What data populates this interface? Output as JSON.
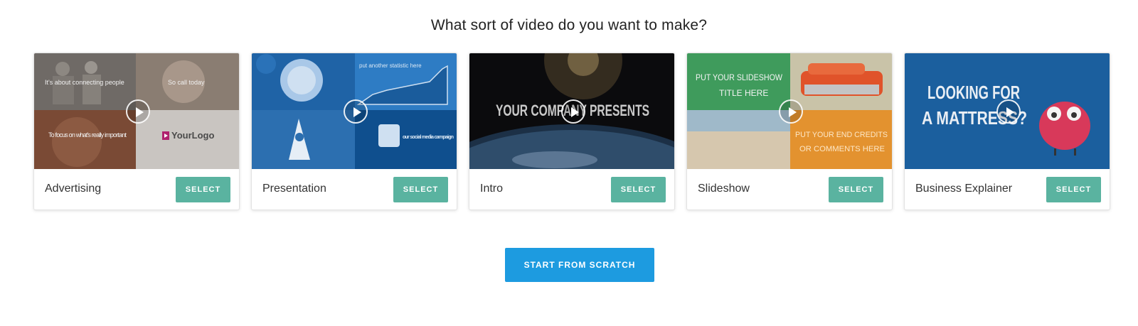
{
  "heading": "What sort of video do you want to make?",
  "cards": [
    {
      "label": "Advertising",
      "select_label": "SELECT",
      "thumb_text": [
        "It's about connecting people",
        "So call today",
        "To focus on what's really important",
        "YourLogo"
      ]
    },
    {
      "label": "Presentation",
      "select_label": "SELECT",
      "thumb_text": [
        "put another statistic here",
        "our social media campaign"
      ]
    },
    {
      "label": "Intro",
      "select_label": "SELECT",
      "thumb_text": [
        "YOUR COMPANY PRESENTS"
      ]
    },
    {
      "label": "Slideshow",
      "select_label": "SELECT",
      "thumb_text": [
        "PUT YOUR SLIDESHOW",
        "TITLE HERE",
        "PUT YOUR END CREDITS",
        "OR COMMENTS HERE"
      ]
    },
    {
      "label": "Business Explainer",
      "select_label": "SELECT",
      "thumb_text": [
        "LOOKING FOR",
        "A MATTRESS?"
      ]
    }
  ],
  "scratch_label": "START FROM SCRATCH",
  "colors": {
    "select_button": "#5ab3a0",
    "scratch_button": "#1d9be0"
  }
}
